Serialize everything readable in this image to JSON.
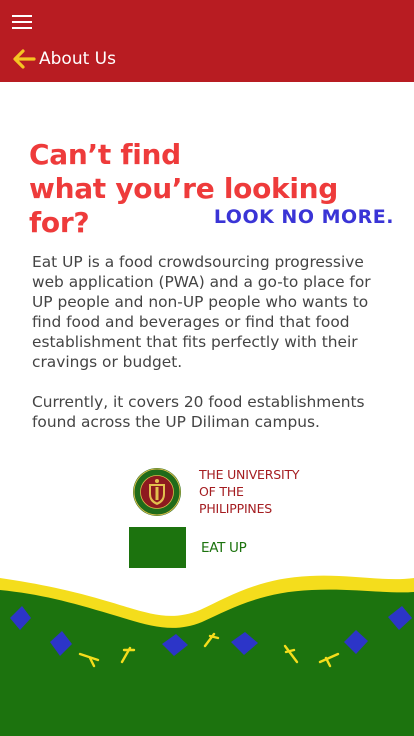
{
  "app_bar": {
    "menu_icon": "hamburger-menu-icon",
    "back_icon": "arrow-left-icon",
    "title": "About Us",
    "color": "#b81c22"
  },
  "hero": {
    "headline_line1": "Can’t find",
    "headline_line2": "what you’re looking for?",
    "subhead": "LOOK NO MORE.",
    "headline_color": "#ee3b3b",
    "subhead_color": "#3a34d6"
  },
  "description": {
    "paragraph1": "Eat UP is a food crowdsourcing progressive web application (PWA) and a go-to place for UP people and non-UP people who wants to find food and beverages or find that food establishment that fits perfectly with their cravings or budget.",
    "paragraph2": "Currently, it covers 20 food establishments found across the UP Diliman campus."
  },
  "logos": {
    "university_line1": "THE UNIVERSITY",
    "university_line2": "OF THE",
    "university_line3": "PHILIPPINES",
    "app_name": "EAT UP",
    "seal_icon": "up-seal-icon",
    "app_logo_color": "#1c730e"
  },
  "footer": {
    "colors": {
      "green": "#1c730e",
      "yellow": "#f4dd1c",
      "blue": "#2c35c8"
    }
  }
}
